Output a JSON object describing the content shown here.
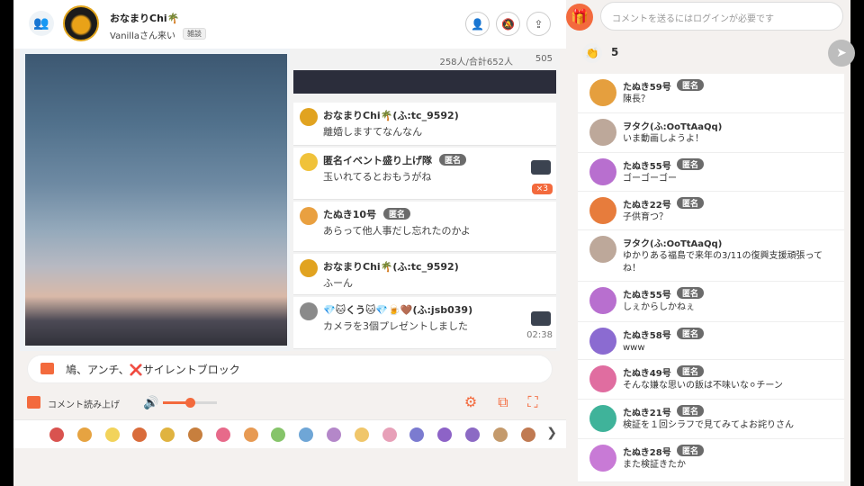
{
  "header": {
    "channel_name": "おなまりChi🌴",
    "subtitle": "Vanillaさん来い",
    "category_tag": "雑談"
  },
  "video": {
    "viewers": "258人/合計652人",
    "comment_count": "505",
    "elapsed": "02:38",
    "gift_multiplier": "×3",
    "overlay_comments": [
      {
        "name": "おなまりChi🌴(ふ:tc_9592)",
        "badge": "",
        "text": "離婚しますてなんなん",
        "avatar": "#e1a320"
      },
      {
        "name": "匿名イベント盛り上げ隊",
        "badge": "匿名",
        "text": "玉いれてるとおもうがね",
        "avatar": "#f0c23a"
      },
      {
        "name": "たぬき10号",
        "badge": "匿名",
        "text": "あらって他人事だし忘れたのかよ",
        "avatar": "#e9a040"
      },
      {
        "name": "おなまりChi🌴(ふ:tc_9592)",
        "badge": "",
        "text": "ふーん",
        "avatar": "#e1a320"
      },
      {
        "name": "💎🐱くう🐱💎🍺🤎(ふ:jsb039)",
        "badge": "",
        "text": "カメラを3個プレゼントしました",
        "avatar": "#8a8a8a"
      }
    ]
  },
  "comment_box": {
    "text": "鳩、アンチ、❌サイレントブロック"
  },
  "controls": {
    "read_aloud": "コメント読み上げ",
    "volume": 0.5
  },
  "gifts": {
    "colors": [
      "#d9534f",
      "#e6a341",
      "#f2d35b",
      "#d96c3b",
      "#e0b340",
      "#c77f3e",
      "#e76a8a",
      "#e79a53",
      "#86c46a",
      "#6fa6d6",
      "#b487c9",
      "#f0c66a",
      "#e7a0b8",
      "#7b7bd0",
      "#8d63c7",
      "#8c6ac4",
      "#c49a6c",
      "#c07a52"
    ]
  },
  "sidebar": {
    "login_placeholder": "コメントを送るにはログインが必要です",
    "clap_count": "5",
    "comments": [
      {
        "name": "たぬき59号",
        "badge": "匿名",
        "text": "陳長？",
        "avatar": "#e59f3e"
      },
      {
        "name": "ヲタク(ふ:OoTtAaQq)",
        "badge": "",
        "text": "いま動画しようよ！",
        "avatar": "#bda89a"
      },
      {
        "name": "たぬき55号",
        "badge": "匿名",
        "text": "ゴーゴーゴー",
        "avatar": "#b86fcf"
      },
      {
        "name": "たぬき22号",
        "badge": "匿名",
        "text": "子供育つ？",
        "avatar": "#e77c3c"
      },
      {
        "name": "ヲタク(ふ:OoTtAaQq)",
        "badge": "",
        "text": "ゆかりある福島で来年の3/11の復興支援頑張ってね！",
        "avatar": "#bda89a"
      },
      {
        "name": "たぬき55号",
        "badge": "匿名",
        "text": "しぇからしかねぇ",
        "avatar": "#b86fcf"
      },
      {
        "name": "たぬき58号",
        "badge": "匿名",
        "text": "www",
        "avatar": "#8b6bd1"
      },
      {
        "name": "たぬき49号",
        "badge": "匿名",
        "text": "そんな嫌な思いの飯は不味いな⚪チーン",
        "avatar": "#e06da0"
      },
      {
        "name": "たぬき21号",
        "badge": "匿名",
        "text": "検証を１回シラフで見てみてよお詫りさん",
        "avatar": "#3fb39a"
      },
      {
        "name": "たぬき28号",
        "badge": "匿名",
        "text": "また検証きたか",
        "avatar": "#c87ad6"
      }
    ]
  }
}
